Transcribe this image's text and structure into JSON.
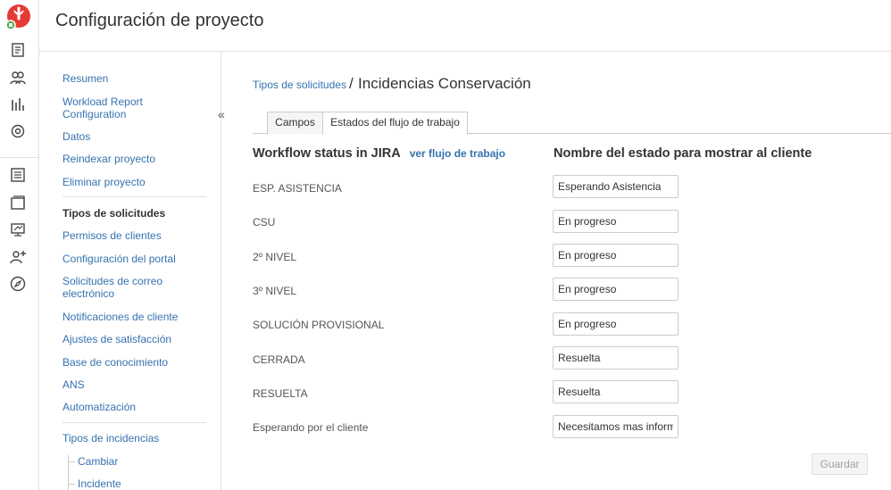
{
  "header": {
    "title": "Configuración de proyecto"
  },
  "rail": {
    "icons": [
      "app-logo-icon",
      "issues-icon",
      "users-icon",
      "reports-icon",
      "settings-icon",
      "queue-icon",
      "board-icon",
      "monitor-icon",
      "add-user-icon",
      "compass-icon"
    ]
  },
  "sidebar": {
    "collapse_label": "«",
    "group1": [
      {
        "label": "Resumen"
      },
      {
        "label": "Workload Report Configuration"
      },
      {
        "label": "Datos"
      },
      {
        "label": "Reindexar proyecto"
      },
      {
        "label": "Eliminar proyecto"
      }
    ],
    "group2": [
      {
        "label": "Tipos de solicitudes"
      },
      {
        "label": "Permisos de clientes"
      },
      {
        "label": "Configuración del portal"
      },
      {
        "label": "Solicitudes de correo electrónico"
      },
      {
        "label": "Notificaciones de cliente"
      },
      {
        "label": "Ajustes de satisfacción"
      },
      {
        "label": "Base de conocimiento"
      },
      {
        "label": "ANS"
      },
      {
        "label": "Automatización"
      }
    ],
    "group3": [
      {
        "label": "Tipos de incidencias"
      },
      {
        "label": "Cambiar"
      },
      {
        "label": "Incidente"
      }
    ]
  },
  "breadcrumb": {
    "parent": "Tipos de solicitudes",
    "separator": "/",
    "current": "Incidencias Conservación"
  },
  "tabs": [
    {
      "label": "Campos"
    },
    {
      "label": "Estados del flujo de trabajo"
    }
  ],
  "columns": {
    "workflow_status": "Workflow status in JIRA",
    "view_workflow_link": "ver flujo de trabajo",
    "customer_name": "Nombre del estado para mostrar al cliente"
  },
  "rows": [
    {
      "status": "ESP. ASISTENCIA",
      "display": "Esperando Asistencia"
    },
    {
      "status": "CSU",
      "display": "En progreso"
    },
    {
      "status": "2º NIVEL",
      "display": "En progreso"
    },
    {
      "status": "3º NIVEL",
      "display": "En progreso"
    },
    {
      "status": "SOLUCIÓN PROVISIONAL",
      "display": "En progreso"
    },
    {
      "status": "CERRADA",
      "display": "Resuelta"
    },
    {
      "status": "RESUELTA",
      "display": "Resuelta"
    },
    {
      "status": "Esperando por el cliente",
      "display": "Necesitamos mas información"
    }
  ],
  "actions": {
    "save_label": "Guardar"
  },
  "colors": {
    "link": "#3572b0",
    "brand_red": "#e53935",
    "border": "#dfe1e5"
  }
}
